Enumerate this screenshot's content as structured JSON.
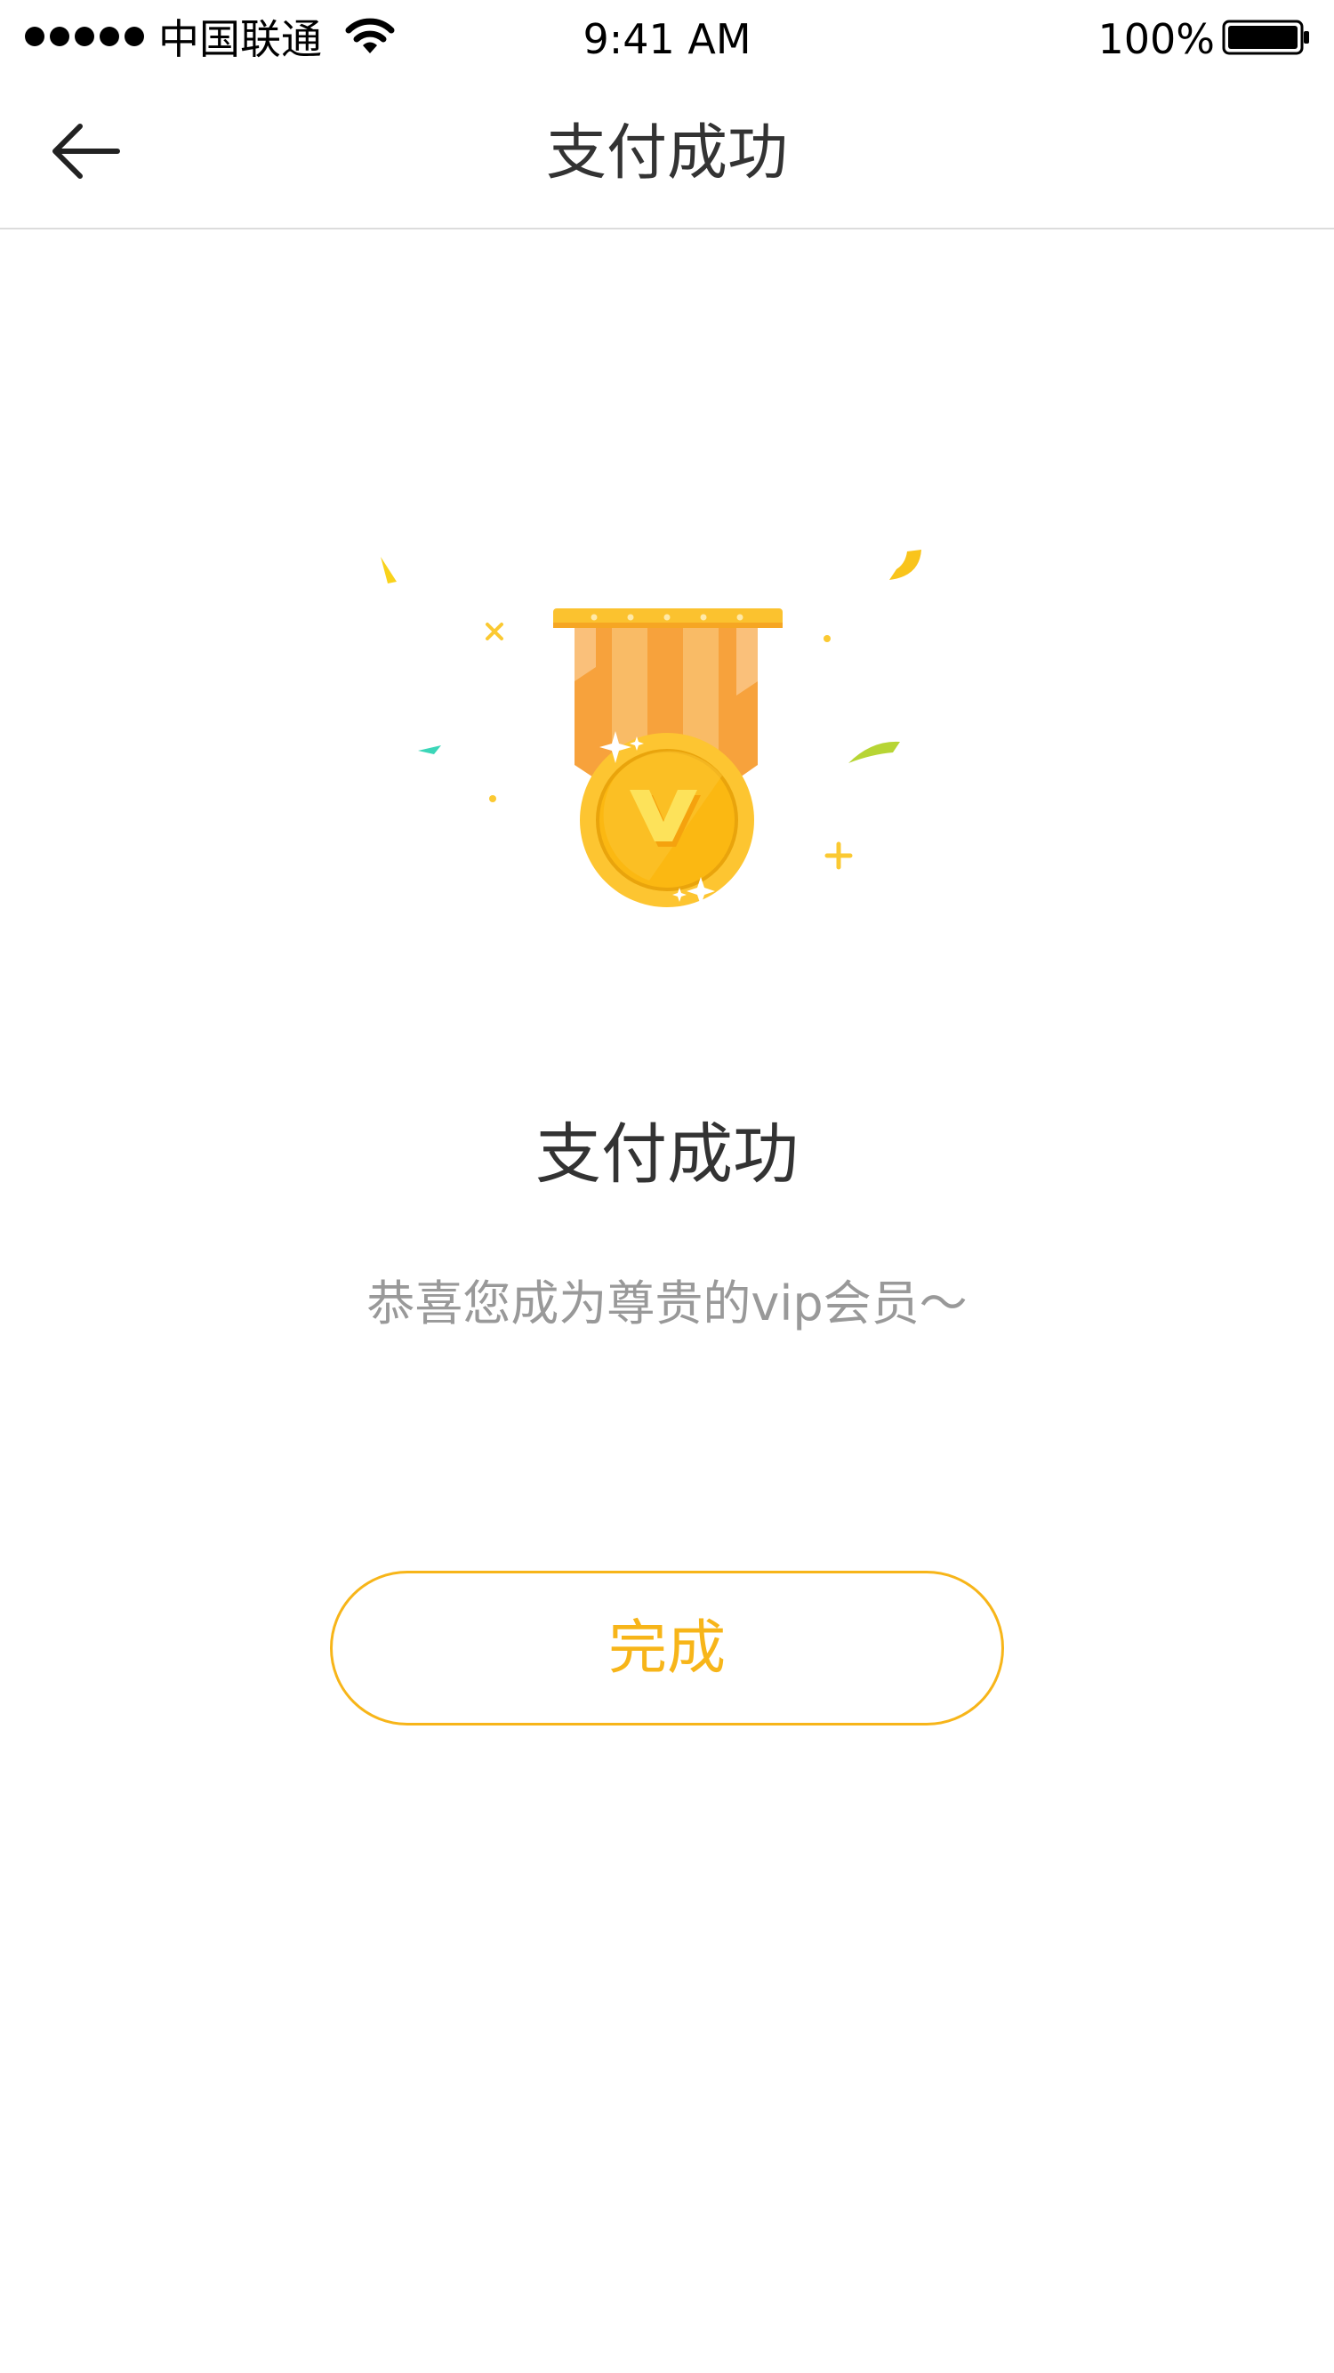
{
  "status_bar": {
    "carrier": "中国联通",
    "time": "9:41 AM",
    "battery": "100%"
  },
  "nav": {
    "title": "支付成功",
    "back_icon": "arrow-left-icon"
  },
  "result": {
    "icon": "vip-medal-icon",
    "medal_letter": "v",
    "title": "支付成功",
    "subtitle": "恭喜您成为尊贵的vip会员～"
  },
  "actions": {
    "done_label": "完成"
  },
  "colors": {
    "accent": "#f7b519",
    "title_text": "#333333",
    "subtitle_text": "#999999",
    "ribbon": "#f7a23c",
    "medal_gold": "#fdc531"
  }
}
